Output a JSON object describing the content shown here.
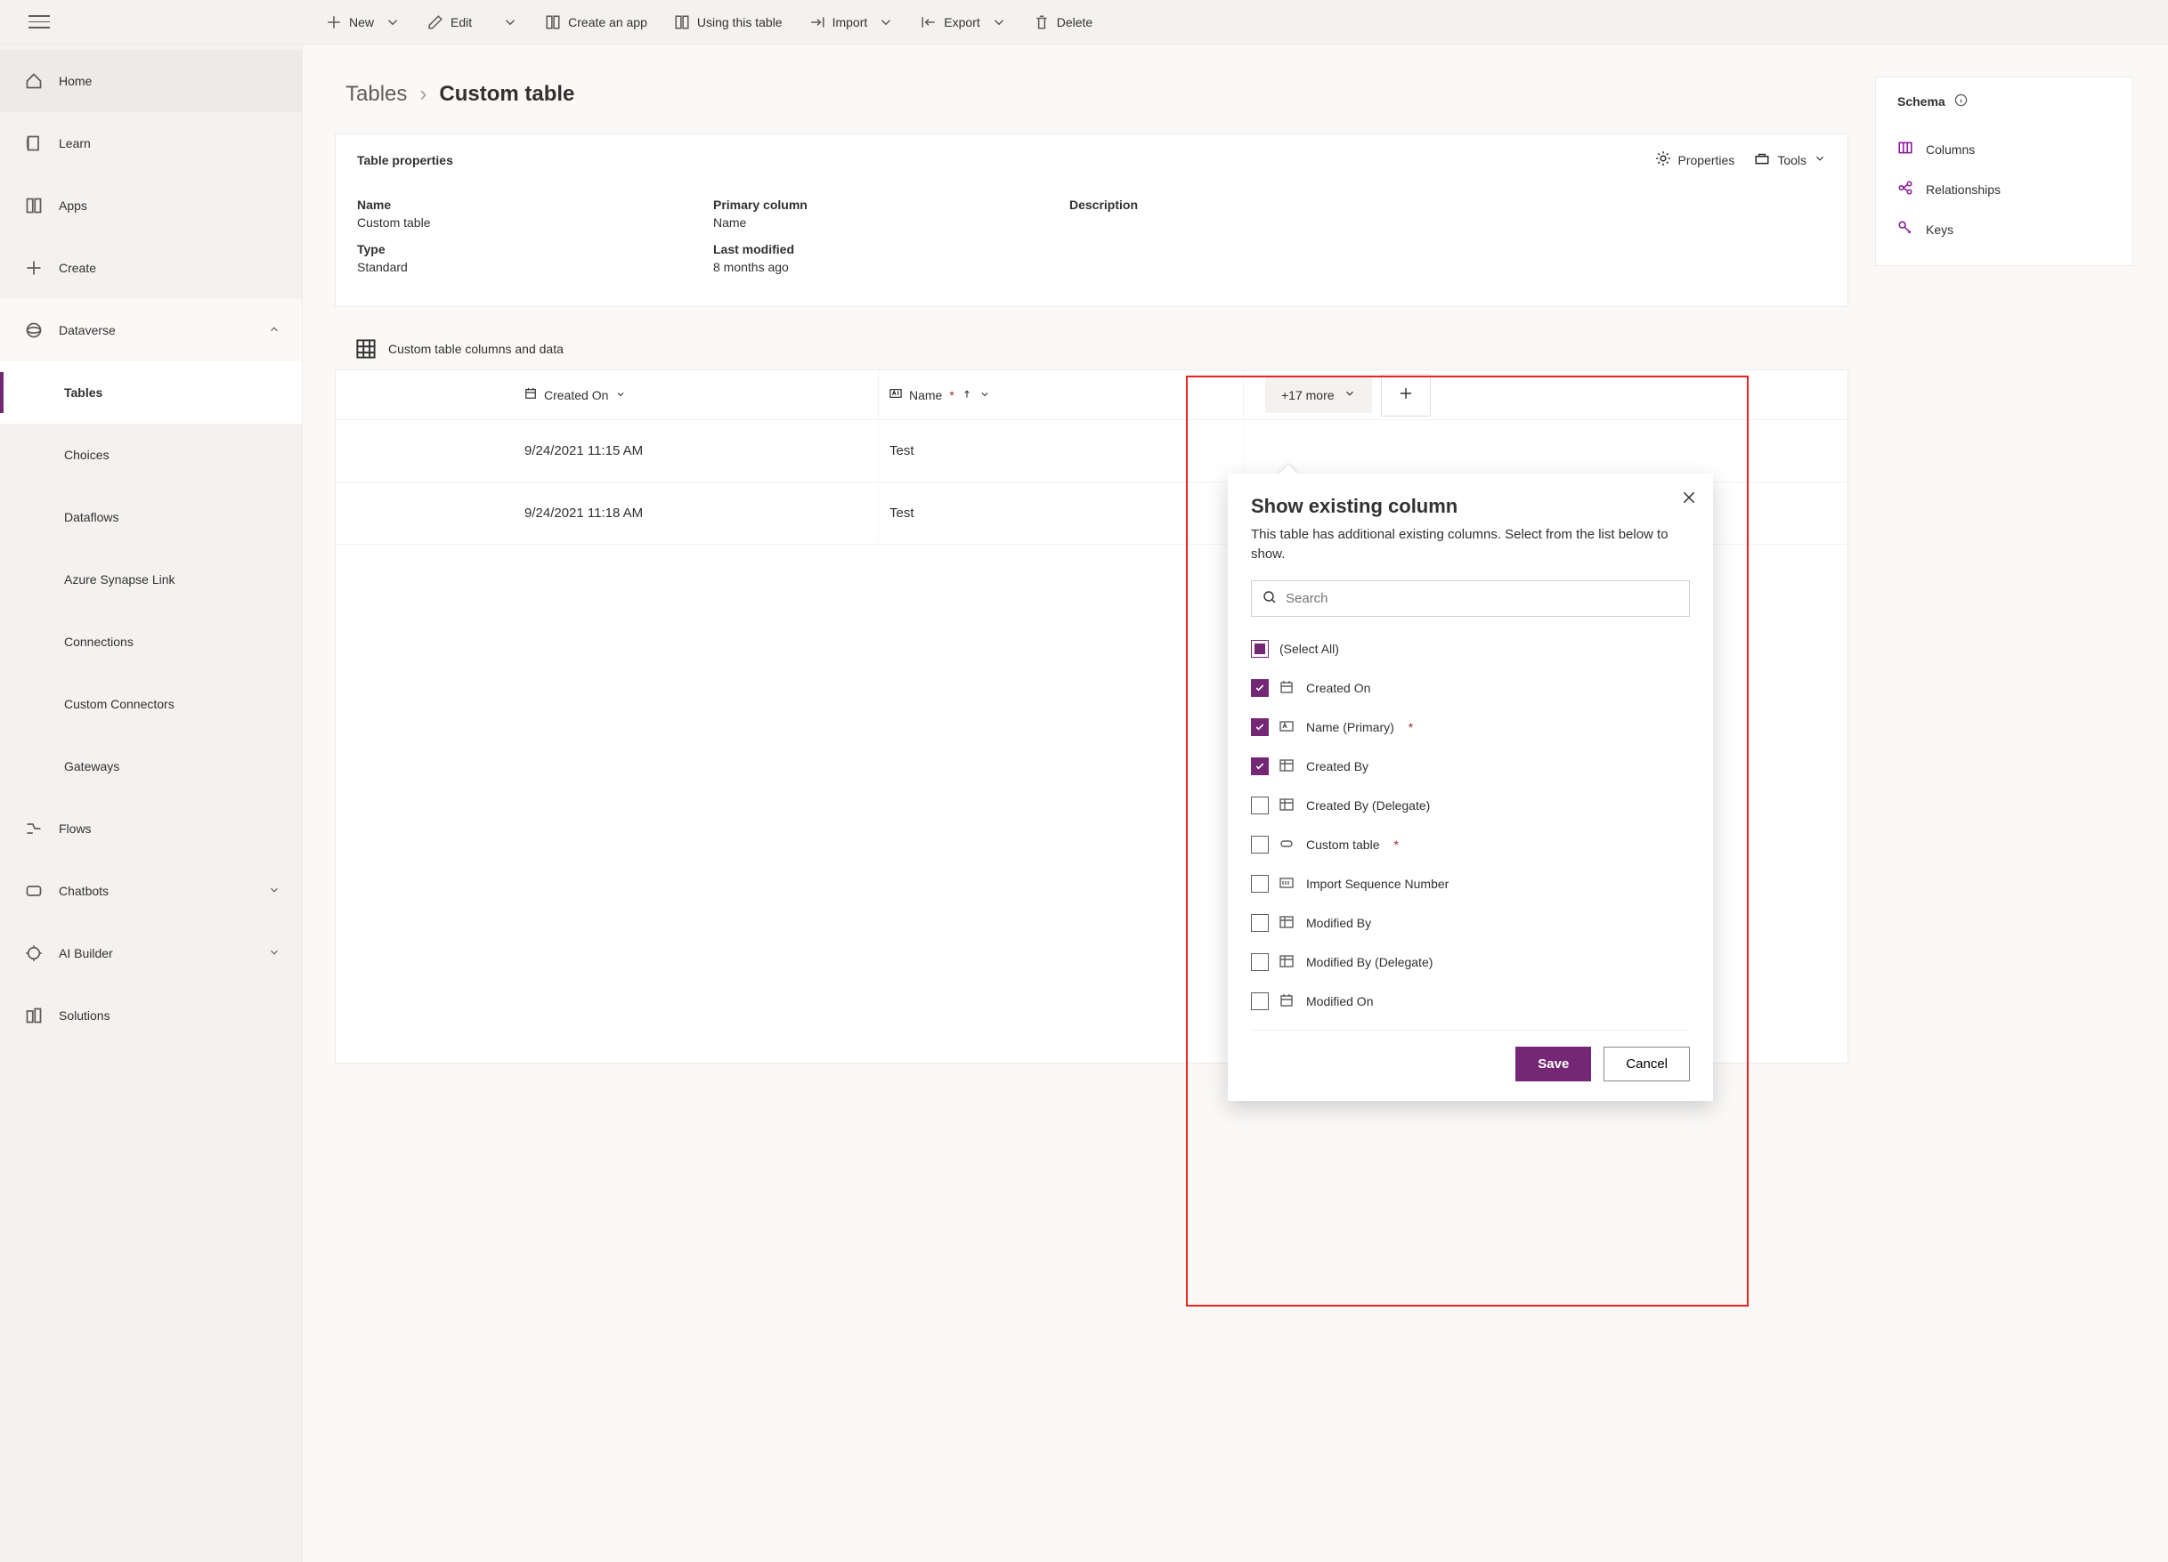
{
  "commands": {
    "new": "New",
    "edit": "Edit",
    "create_app": "Create an app",
    "using_table": "Using this table",
    "import": "Import",
    "export": "Export",
    "delete": "Delete"
  },
  "nav": {
    "home": "Home",
    "learn": "Learn",
    "apps": "Apps",
    "create": "Create",
    "dataverse": "Dataverse",
    "tables": "Tables",
    "choices": "Choices",
    "dataflows": "Dataflows",
    "synapse": "Azure Synapse Link",
    "connections": "Connections",
    "custom_connectors": "Custom Connectors",
    "gateways": "Gateways",
    "flows": "Flows",
    "chatbots": "Chatbots",
    "ai_builder": "AI Builder",
    "solutions": "Solutions"
  },
  "breadcrumb": {
    "root": "Tables",
    "current": "Custom table"
  },
  "props": {
    "header": "Table properties",
    "properties_action": "Properties",
    "tools_action": "Tools",
    "name_label": "Name",
    "name_value": "Custom table",
    "primary_col_label": "Primary column",
    "primary_col_value": "Name",
    "description_label": "Description",
    "description_value": "",
    "type_label": "Type",
    "type_value": "Standard",
    "last_modified_label": "Last modified",
    "last_modified_value": "8 months ago"
  },
  "schema": {
    "header": "Schema",
    "columns": "Columns",
    "relationships": "Relationships",
    "keys": "Keys"
  },
  "data_section": {
    "title": "Custom table columns and data",
    "col_created": "Created On",
    "col_name": "Name",
    "more_badge": "+17 more",
    "rows": [
      {
        "created": "9/24/2021 11:15 AM",
        "name": "Test"
      },
      {
        "created": "9/24/2021 11:18 AM",
        "name": "Test"
      }
    ]
  },
  "flyout": {
    "title": "Show existing column",
    "subtitle": "This table has additional existing columns. Select from the list below to show.",
    "search_placeholder": "Search",
    "items": [
      {
        "label": "(Select All)",
        "state": "indeterminate",
        "icon": ""
      },
      {
        "label": "Created On",
        "state": "checked",
        "icon": "date"
      },
      {
        "label": "Name (Primary)",
        "state": "checked",
        "icon": "text",
        "required": true
      },
      {
        "label": "Created By",
        "state": "checked",
        "icon": "lookup"
      },
      {
        "label": "Created By (Delegate)",
        "state": "",
        "icon": "lookup"
      },
      {
        "label": "Custom table",
        "state": "",
        "icon": "key",
        "required": true
      },
      {
        "label": "Import Sequence Number",
        "state": "",
        "icon": "number"
      },
      {
        "label": "Modified By",
        "state": "",
        "icon": "lookup"
      },
      {
        "label": "Modified By (Delegate)",
        "state": "",
        "icon": "lookup"
      },
      {
        "label": "Modified On",
        "state": "",
        "icon": "date"
      }
    ],
    "save": "Save",
    "cancel": "Cancel"
  }
}
